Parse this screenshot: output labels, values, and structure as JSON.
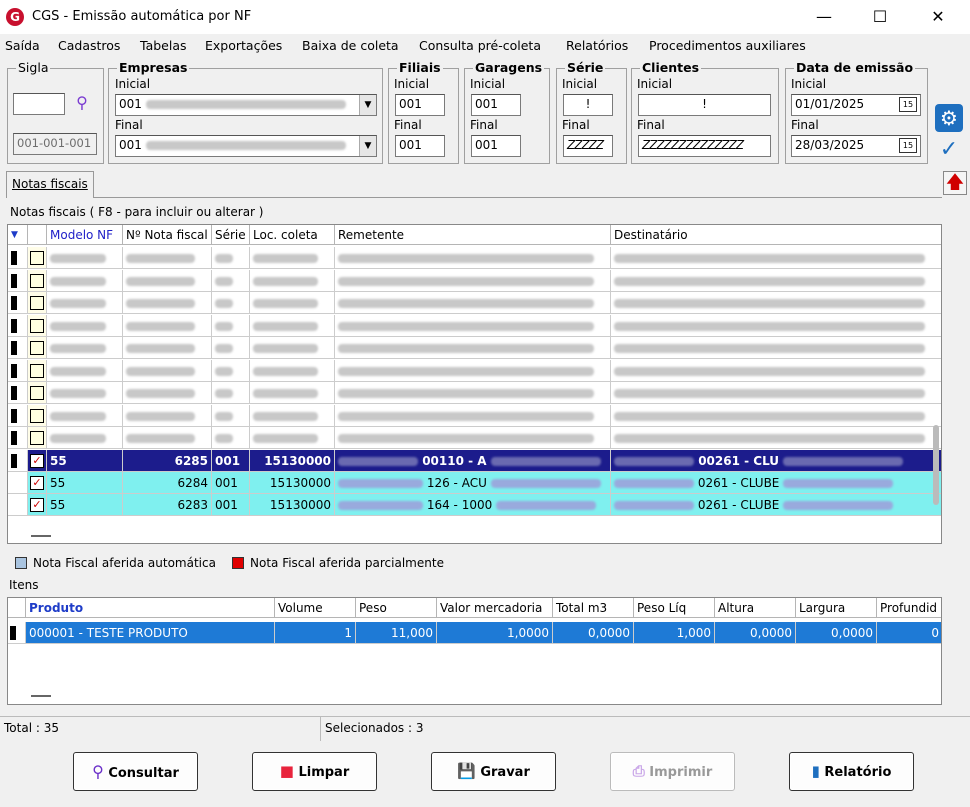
{
  "window": {
    "title": "CGS - Emissão automática por NF",
    "logo": "G"
  },
  "menu": [
    "Saída",
    "Cadastros",
    "Tabelas",
    "Exportações",
    "Baixa de coleta",
    "Consulta pré-coleta",
    "Relatórios",
    "Procedimentos auxiliares"
  ],
  "filters": {
    "sigla": {
      "title": "Sigla",
      "value": "",
      "code": "001-001-001"
    },
    "empresas": {
      "title": "Empresas",
      "inicial_label": "Inicial",
      "inicial": "001",
      "final_label": "Final",
      "final": "001"
    },
    "filiais": {
      "title": "Filiais",
      "inicial_label": "Inicial",
      "inicial": "001",
      "final_label": "Final",
      "final": "001"
    },
    "garagens": {
      "title": "Garagens",
      "inicial_label": "Inicial",
      "inicial": "001",
      "final_label": "Final",
      "final": "001"
    },
    "serie": {
      "title": "Série",
      "inicial_label": "Inicial",
      "inicial": "!",
      "final_label": "Final",
      "final": "ZZZZZ"
    },
    "clientes": {
      "title": "Clientes",
      "inicial_label": "Inicial",
      "inicial": "!",
      "final_label": "Final",
      "final": "ZZZZZZZZZZZZZZ"
    },
    "data_emissao": {
      "title": "Data de emissão",
      "inicial_label": "Inicial",
      "inicial": "01/01/2025",
      "final_label": "Final",
      "final": "28/03/2025"
    }
  },
  "tab": {
    "label": "Notas fiscais"
  },
  "notas": {
    "caption": "Notas fiscais ( F8 - para incluir ou alterar )",
    "columns": [
      "Modelo NF",
      "Nº Nota fiscal",
      "Série",
      "Loc. coleta",
      "Remetente",
      "Destinatário"
    ],
    "selected_rows": [
      {
        "modelo": "55",
        "numero": "6285",
        "serie": "001",
        "loc": "15130000",
        "remetente": "00110 - A",
        "destinatario": "00261 - CLU"
      },
      {
        "modelo": "55",
        "numero": "6284",
        "serie": "001",
        "loc": "15130000",
        "remetente": "126 - ACU",
        "destinatario": "0261 - CLUBE"
      },
      {
        "modelo": "55",
        "numero": "6283",
        "serie": "001",
        "loc": "15130000",
        "remetente": "164 - 1000",
        "destinatario": "0261 - CLUBE"
      }
    ]
  },
  "legend": {
    "auto": "Nota Fiscal aferida automática",
    "parcial": "Nota Fiscal aferida parcialmente",
    "auto_color": "#a9c4e0",
    "parcial_color": "#e00000"
  },
  "itens": {
    "caption": "Itens",
    "columns": [
      "Produto",
      "Volume",
      "Peso",
      "Valor mercadoria",
      "Total m3",
      "Peso Líq",
      "Altura",
      "Largura",
      "Profundid"
    ],
    "rows": [
      {
        "produto": "000001 - TESTE PRODUTO",
        "volume": "1",
        "peso": "11,000",
        "valor": "1,0000",
        "total_m3": "0,0000",
        "peso_liq": "1,000",
        "altura": "0,0000",
        "largura": "0,0000",
        "profundidade": "0"
      }
    ]
  },
  "status": {
    "total": "Total : 35",
    "selecionados": "Selecionados : 3"
  },
  "buttons": {
    "consultar": "Consultar",
    "limpar": "Limpar",
    "gravar": "Gravar",
    "imprimir": "Imprimir",
    "relatorio": "Relatório"
  },
  "colors": {
    "selected_row": "#1c1c8c",
    "checked_row": "#7ff0ef",
    "accent": "#1e6fbf"
  }
}
